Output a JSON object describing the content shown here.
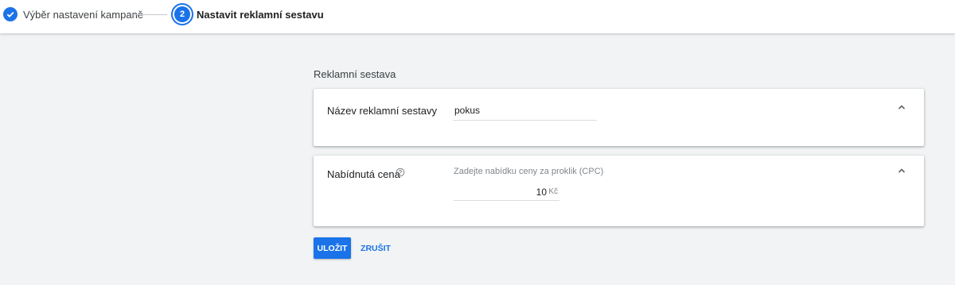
{
  "stepper": {
    "step1": {
      "label": "Výběr nastavení kampaně",
      "icon": "check-icon",
      "status": "completed"
    },
    "step2": {
      "number": "2",
      "label": "Nastavit reklamní sestavu",
      "status": "active"
    }
  },
  "section": {
    "title": "Reklamní sestava"
  },
  "ad_group_name": {
    "label": "Název reklamní sestavy",
    "value": "pokus",
    "expand_icon": "chevron-up-icon"
  },
  "bid": {
    "label": "Nabídnutá cena",
    "help_icon": "help-icon",
    "hint": "Zadejte nabídku ceny za proklik (CPC)",
    "value": "10",
    "currency": "Kč",
    "expand_icon": "chevron-up-icon"
  },
  "actions": {
    "save_label": "ULOŽIT",
    "cancel_label": "ZRUŠIT"
  },
  "colors": {
    "accent": "#1a73e8",
    "background": "#f1f3f4",
    "card": "#ffffff"
  }
}
